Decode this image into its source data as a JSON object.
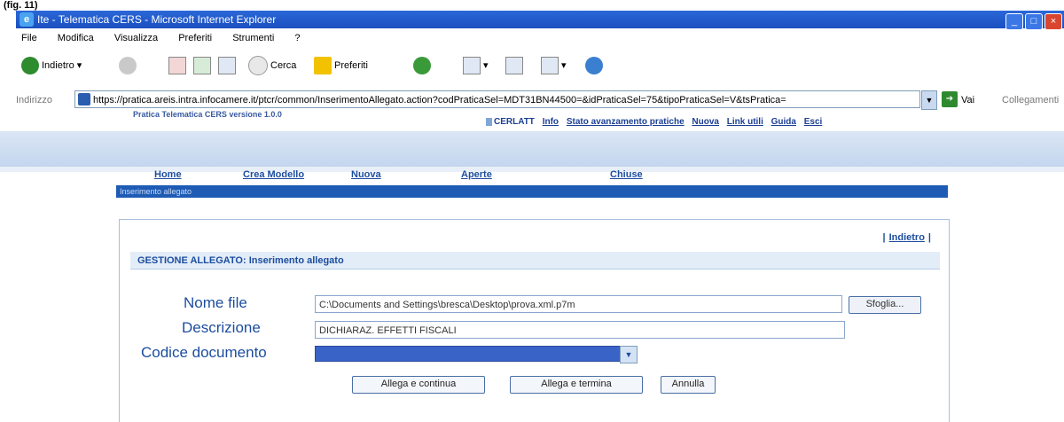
{
  "figure_label": "(fig. 11)",
  "window": {
    "title": "Ite - Telematica CERS - Microsoft Internet Explorer",
    "min": "_",
    "max": "□",
    "close": "×"
  },
  "menu": [
    "File",
    "Modifica",
    "Visualizza",
    "Preferiti",
    "Strumenti",
    "?"
  ],
  "toolbar": {
    "back": "Indietro",
    "search": "Cerca",
    "favorites": "Preferiti"
  },
  "address": {
    "label": "Indirizzo",
    "url": "https://pratica.areis.intra.infocamere.it/ptcr/common/InserimentoAllegato.action?codPraticaSel=MDT31BN44500=&idPraticaSel=75&tipoPraticaSel=V&tsPratica=",
    "go": "Vai",
    "links": "Collegamenti"
  },
  "app": {
    "header": "Pratica Telematica CERS versione 1.0.0",
    "user": "CERLATT",
    "user_links": [
      "Info",
      "Stato avanzamento pratiche",
      "Nuova",
      "Link utili",
      "Guida",
      "Esci"
    ]
  },
  "nav": {
    "links": [
      "Home",
      "Crea Modello",
      "Nuova",
      "Aperte",
      "Chiuse"
    ],
    "crumb": "Inserimento allegato"
  },
  "panel": {
    "back_link": "Indietro",
    "section_title": "GESTIONE ALLEGATO: Inserimento allegato",
    "file_label": "Nome file",
    "file_value": "C:\\Documents and Settings\\bresca\\Desktop\\prova.xml.p7m",
    "browse": "Sfoglia...",
    "desc_label": "Descrizione",
    "desc_value": "DICHIARAZ. EFFETTI FISCALI",
    "code_label": "Codice documento",
    "code_value": "",
    "buttons": {
      "attach_continue": "Allega e continua",
      "attach_finish": "Allega e termina",
      "cancel": "Annulla"
    }
  }
}
